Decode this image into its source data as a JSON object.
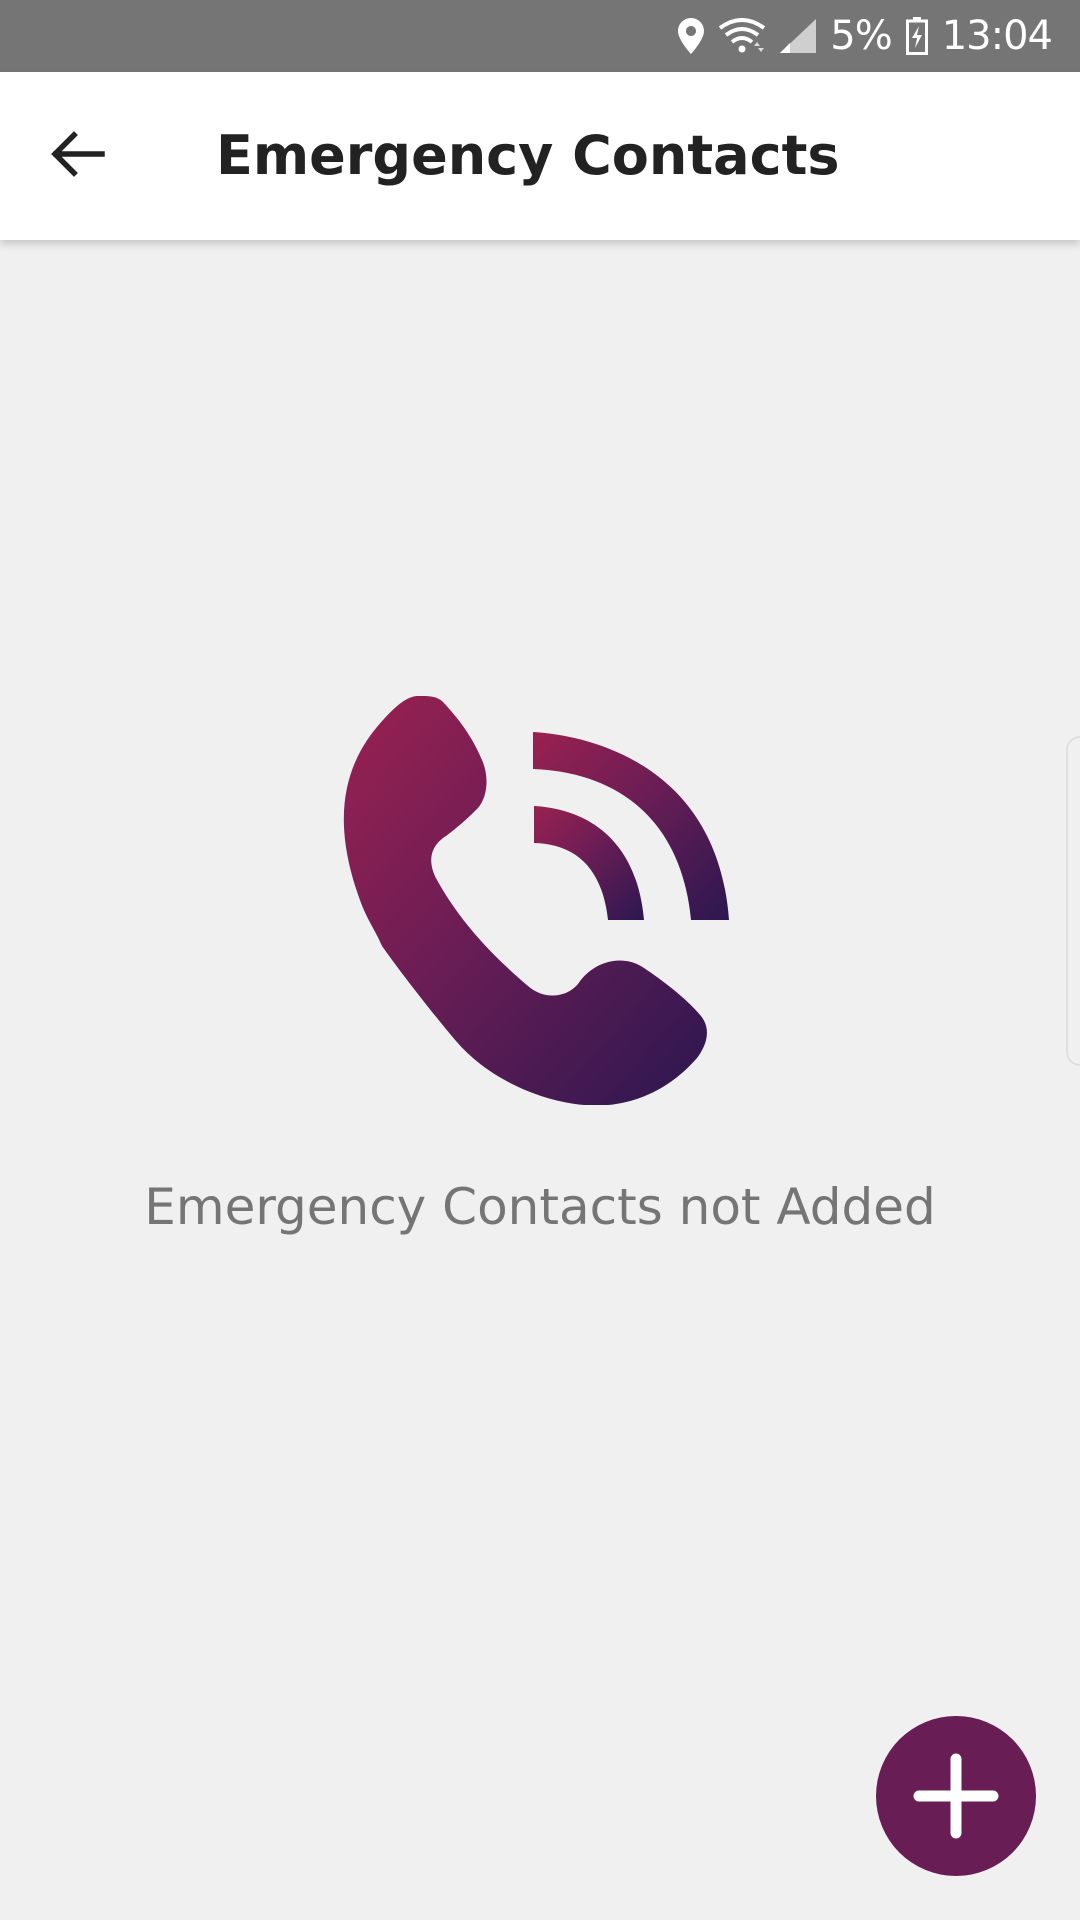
{
  "status_bar": {
    "battery_percent": "5%",
    "time": "13:04",
    "icons": [
      "location-icon",
      "wifi-icon",
      "signal-icon",
      "battery-charging-icon"
    ]
  },
  "header": {
    "title": "Emergency Contacts",
    "back_icon": "arrow-left-icon"
  },
  "empty_state": {
    "message": "Emergency Contacts not Added",
    "illustration_icon": "phone-ringing-icon",
    "gradient_start": "#9a2150",
    "gradient_end": "#2c1750"
  },
  "fab": {
    "icon": "plus-icon",
    "color": "#681d54"
  },
  "colors": {
    "status_bar": "#757575",
    "background": "#f1f0f1",
    "app_bar": "#ffffff",
    "message_text": "#757575"
  }
}
